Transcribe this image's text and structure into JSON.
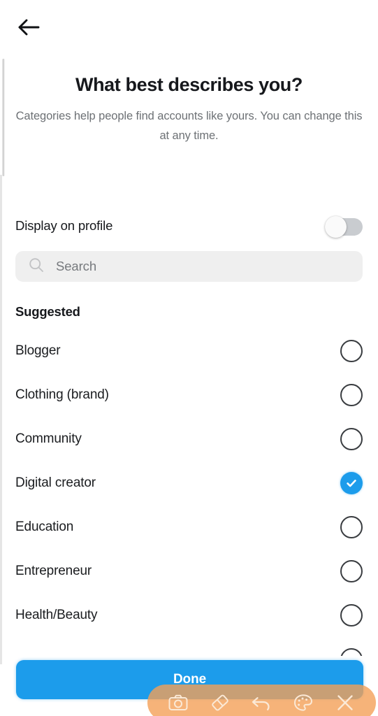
{
  "app": {
    "screen_name": "Category selection"
  },
  "topbar": {
    "back_icon": "arrow-left-icon"
  },
  "header": {
    "title": "What best describes you?",
    "subtitle": "Categories help people find accounts like yours. You can change this at any time."
  },
  "display_toggle": {
    "label": "Display on profile",
    "state": "off"
  },
  "search": {
    "placeholder": "Search",
    "value": "",
    "icon": "search-icon"
  },
  "suggested": {
    "section_label": "Suggested",
    "items": [
      {
        "label": "Blogger",
        "selected": false
      },
      {
        "label": "Clothing (brand)",
        "selected": false
      },
      {
        "label": "Community",
        "selected": false
      },
      {
        "label": "Digital creator",
        "selected": true
      },
      {
        "label": "Education",
        "selected": false
      },
      {
        "label": "Entrepreneur",
        "selected": false
      },
      {
        "label": "Health/Beauty",
        "selected": false
      },
      {
        "label": "",
        "selected": false
      }
    ]
  },
  "cta": {
    "label": "Done"
  },
  "annotation_toolbar": {
    "buttons": [
      {
        "name": "camera-icon",
        "label": "Screenshot"
      },
      {
        "name": "eraser-icon",
        "label": "Eraser"
      },
      {
        "name": "undo-icon",
        "label": "Undo"
      },
      {
        "name": "palette-icon",
        "label": "Color"
      },
      {
        "name": "close-icon",
        "label": "Close"
      }
    ]
  },
  "colors": {
    "accent": "#1c9ceb",
    "background": "#ffffff",
    "text_primary": "#16181c",
    "text_secondary": "#6d7175",
    "search_field": "#efefef",
    "toolbar_overlay": "#f4a058"
  }
}
